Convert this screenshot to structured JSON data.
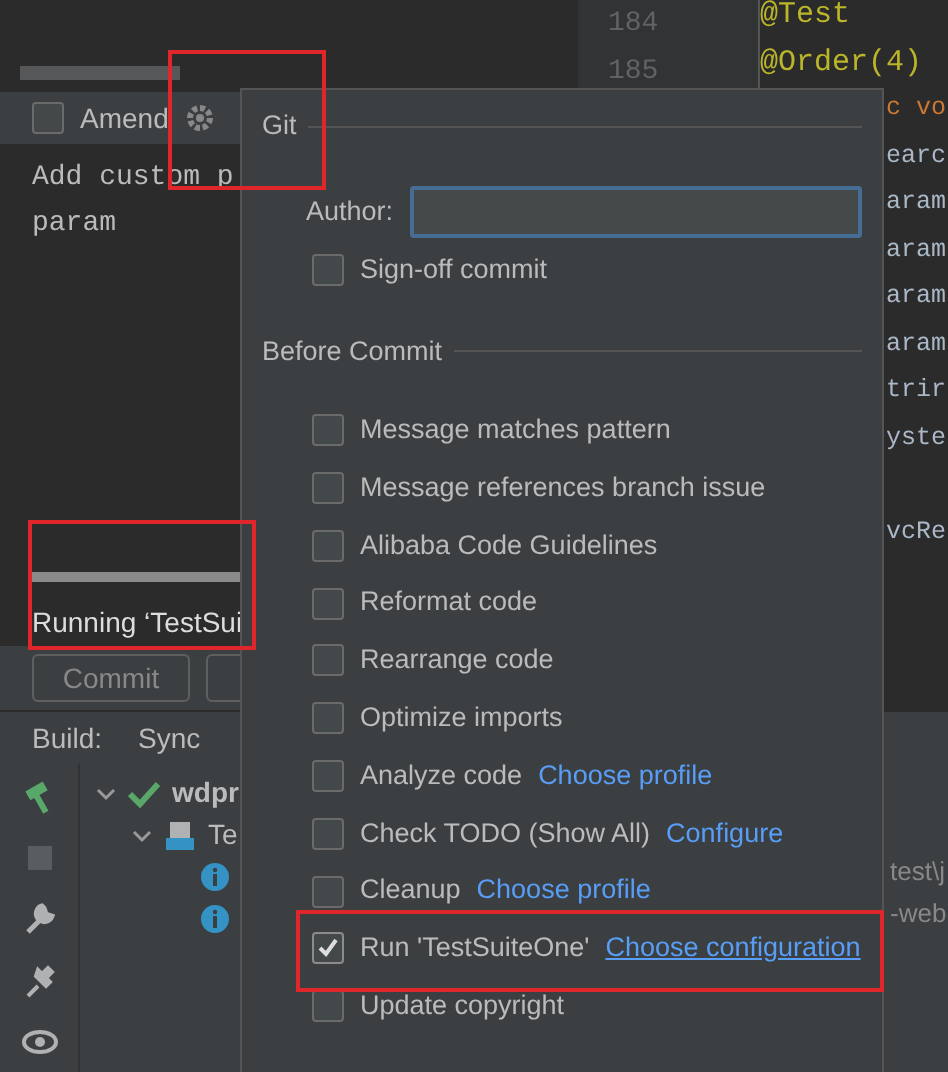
{
  "commit_panel": {
    "amend": {
      "label": "Amend",
      "checked": false
    },
    "message_lines": [
      "Add custom p",
      "param"
    ],
    "progress": {
      "level": 1
    },
    "status": "Running ‘TestSui",
    "buttons": [
      "Commit"
    ]
  },
  "editor": {
    "line_numbers": [
      "184",
      "185"
    ],
    "lines": [
      {
        "text": "@Test",
        "kind": "annotation"
      },
      {
        "text": "@Order(4)",
        "kind": "annotation"
      },
      {
        "text": "c vo",
        "kind": "keyword"
      },
      {
        "text": "earc",
        "kind": "plain"
      },
      {
        "text": "aram",
        "kind": "plain"
      },
      {
        "text": "aram",
        "kind": "plain"
      },
      {
        "text": "aram",
        "kind": "plain"
      },
      {
        "text": "aram",
        "kind": "plain"
      },
      {
        "text": "trir",
        "kind": "plain"
      },
      {
        "text": "yste",
        "kind": "plain"
      },
      {
        "kind": "blank"
      },
      {
        "text": "vcRe",
        "kind": "plain"
      }
    ]
  },
  "build_pane": {
    "label": "Build:",
    "tabs": [
      {
        "label": "Sync",
        "selected": true
      }
    ],
    "tree": [
      {
        "label": "wdpr",
        "kind": "success",
        "expanded": true,
        "children": [
          {
            "label": "Te",
            "kind": "suite",
            "expanded": true,
            "children": [
              {
                "kind": "info"
              },
              {
                "kind": "info"
              }
            ]
          }
        ]
      }
    ],
    "output_fragments": [
      "test\\j",
      "-web"
    ]
  },
  "popup": {
    "title": "Git",
    "author": {
      "label": "Author:"
    },
    "sign_off": {
      "label": "Sign-off commit",
      "checked": false
    },
    "section_title": "Before Commit",
    "options": [
      {
        "label": "Message matches pattern",
        "checked": false
      },
      {
        "label": "Message references branch issue",
        "checked": false
      },
      {
        "label": "Alibaba Code Guidelines",
        "checked": false
      },
      {
        "label": "Reformat code",
        "checked": false
      },
      {
        "label": "Rearrange code",
        "checked": false
      },
      {
        "label": "Optimize imports",
        "checked": false
      },
      {
        "label": "Analyze code",
        "checked": false,
        "link": "Choose profile",
        "link_hovered": false
      },
      {
        "label": "Check TODO (Show All)",
        "checked": false,
        "link": "Configure",
        "link_hovered": false
      },
      {
        "label": "Cleanup",
        "checked": false,
        "link": "Choose profile",
        "link_hovered": false
      },
      {
        "label": "Run 'TestSuiteOne'",
        "checked": true,
        "link": "Choose configuration",
        "link_hovered": true
      },
      {
        "label": "Update copyright",
        "checked": false
      }
    ]
  }
}
